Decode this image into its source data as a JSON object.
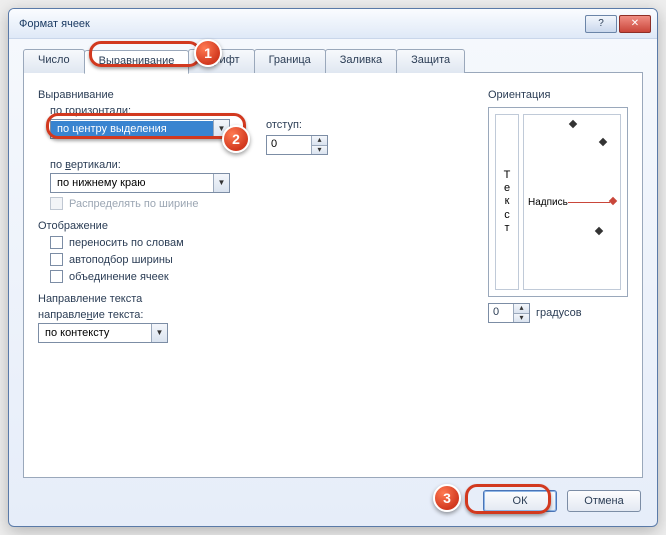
{
  "window": {
    "title": "Формат ячеек"
  },
  "tabs": [
    "Число",
    "Выравнивание",
    "Шрифт",
    "Граница",
    "Заливка",
    "Защита"
  ],
  "active_tab_index": 1,
  "alignment": {
    "group_label": "Выравнивание",
    "horizontal_label_pre": "по ",
    "horizontal_label_u": "г",
    "horizontal_label_post": "оризонтали:",
    "horizontal_value": "по центру выделения",
    "indent_label_pre": "",
    "indent_label_u": "о",
    "indent_label_post": "тступ:",
    "indent_value": "0",
    "vertical_label_pre": "по ",
    "vertical_label_u": "в",
    "vertical_label_post": "ертикали:",
    "vertical_value": "по нижнему краю",
    "distribute_label": "Распределять по ширине"
  },
  "display": {
    "group_label": "Отображение",
    "wrap_label_pre": "перенос",
    "wrap_label_u": "и",
    "wrap_label_post": "ть по словам",
    "shrink_label_pre": "",
    "shrink_label_u": "а",
    "shrink_label_post": "втоподбор ширины",
    "merge_label_pre": "объединение ",
    "merge_label_u": "я",
    "merge_label_post": "чеек"
  },
  "direction": {
    "group_label": "Направление текста",
    "field_label_pre": "направле",
    "field_label_u": "н",
    "field_label_post": "ие текста:",
    "value": "по контексту"
  },
  "orientation": {
    "group_label": "Ориентация",
    "vertical_text": "Текст",
    "text": "Надпись",
    "degrees_value": "0",
    "degrees_label": "градусов"
  },
  "buttons": {
    "ok": "ОК",
    "cancel": "Отмена"
  },
  "steps": {
    "one": "1",
    "two": "2",
    "three": "3"
  }
}
